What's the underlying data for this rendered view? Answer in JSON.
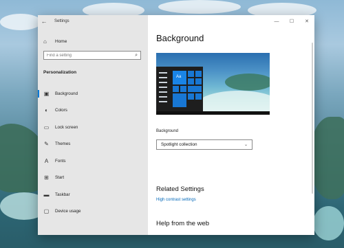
{
  "window": {
    "title": "Settings",
    "controls": [
      "—",
      "☐",
      "✕"
    ]
  },
  "sidebar": {
    "home_label": "Home",
    "search_placeholder": "Find a setting",
    "section_title": "Personalization",
    "items": [
      {
        "label": "Background",
        "icon": "picture-icon",
        "glyph": "▣",
        "active": true
      },
      {
        "label": "Colors",
        "icon": "palette-icon",
        "glyph": "◐"
      },
      {
        "label": "Lock screen",
        "icon": "lock-screen-icon",
        "glyph": "▭"
      },
      {
        "label": "Themes",
        "icon": "brush-icon",
        "glyph": "✎"
      },
      {
        "label": "Fonts",
        "icon": "fonts-icon",
        "glyph": "A"
      },
      {
        "label": "Start",
        "icon": "start-icon",
        "glyph": "⊞"
      },
      {
        "label": "Taskbar",
        "icon": "taskbar-icon",
        "glyph": "▬"
      },
      {
        "label": "Device usage",
        "icon": "device-icon",
        "glyph": "▢"
      }
    ]
  },
  "main": {
    "title": "Background",
    "preview_tile_text": "Aa",
    "background_label": "Background",
    "background_value": "Spotlight collection",
    "related_settings_title": "Related Settings",
    "related_link": "High contrast settings",
    "help_title": "Help from the web"
  },
  "colors": {
    "accent": "#0078d7",
    "link": "#0067b8",
    "sidebar_bg": "#e6e6e6"
  }
}
